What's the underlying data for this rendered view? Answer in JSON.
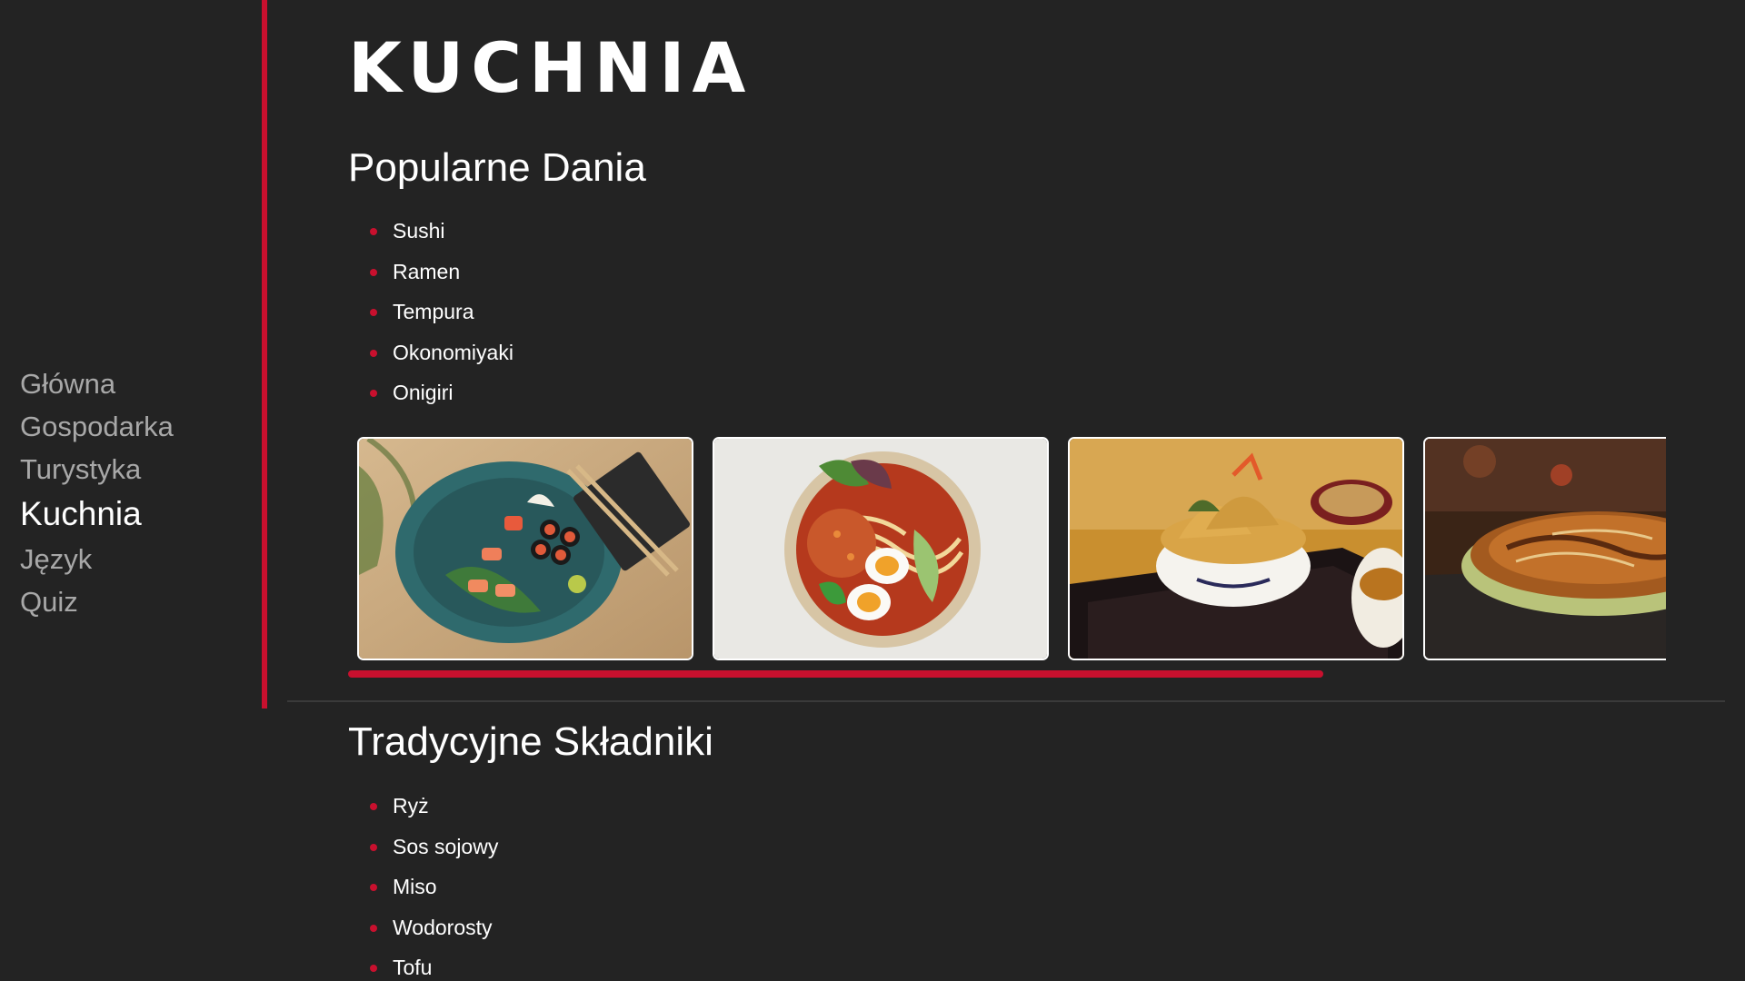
{
  "logo": "KUCHNIA",
  "nav": {
    "items": [
      {
        "label": "Główna"
      },
      {
        "label": "Gospodarka"
      },
      {
        "label": "Turystyka"
      },
      {
        "label": "Kuchnia"
      },
      {
        "label": "Język"
      },
      {
        "label": "Quiz"
      }
    ],
    "active": "Kuchnia"
  },
  "popular": {
    "title": "Popularne Dania",
    "items": [
      "Sushi",
      "Ramen",
      "Tempura",
      "Okonomiyaki",
      "Onigiri"
    ]
  },
  "gallery": {
    "photos": [
      {
        "icon": "sushi-photo"
      },
      {
        "icon": "ramen-photo"
      },
      {
        "icon": "tempura-photo"
      },
      {
        "icon": "okonomiyaki-photo"
      }
    ],
    "scroll_fraction_visible": 0.74
  },
  "ingredients": {
    "title": "Tradycyjne Składniki",
    "items": [
      "Ryż",
      "Sos sojowy",
      "Miso",
      "Wodorosty",
      "Tofu"
    ]
  },
  "colors": {
    "background": "#232323",
    "accent": "#c8102e",
    "text": "#ffffff",
    "nav_inactive": "#a8a8a8"
  }
}
